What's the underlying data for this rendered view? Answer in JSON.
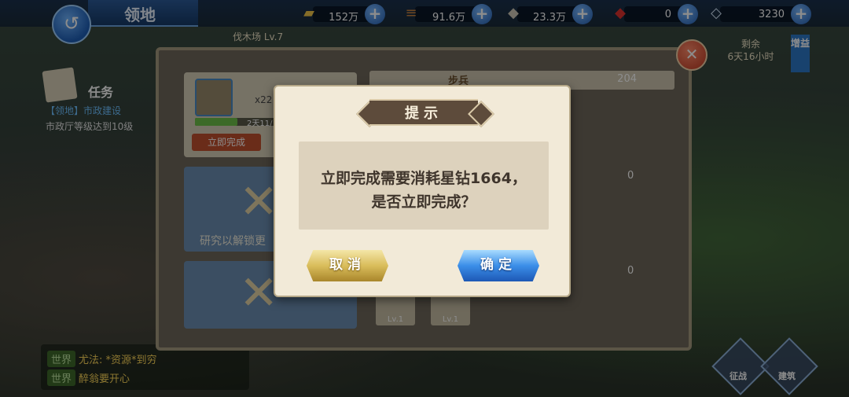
{
  "header": {
    "title": "领地",
    "resources": [
      {
        "icon": "gold-icon",
        "value": "152万"
      },
      {
        "icon": "wood-icon",
        "value": "91.6万"
      },
      {
        "icon": "stone-icon",
        "value": "23.3万"
      },
      {
        "icon": "ruby-icon",
        "value": "0"
      },
      {
        "icon": "diamond-icon",
        "value": "3230"
      }
    ]
  },
  "building": {
    "subtitle": "伐木场 Lv.7",
    "remaining_label": "剩余",
    "remaining_time": "6天16小时",
    "boost_label": "增益"
  },
  "task": {
    "heading": "任务",
    "link": "【领地】市政建设",
    "desc": "市政厅等级达到10级"
  },
  "production": {
    "count": "x22",
    "time": "2天11/",
    "progress": 0.45,
    "finish_now": "立即完成"
  },
  "locked_card": {
    "text": "研究以解锁更"
  },
  "right_rows": [
    {
      "label": "步兵",
      "value": "204"
    },
    {
      "label": "",
      "value": "0"
    },
    {
      "label": "",
      "value": "0"
    }
  ],
  "mini_items": [
    {
      "lv": "Lv.1"
    },
    {
      "lv": "Lv.1"
    }
  ],
  "chat": [
    {
      "tag": "世界",
      "msg": "尤法: *资源*到穷"
    },
    {
      "tag": "世界",
      "msg": "醉翁要开心"
    }
  ],
  "corner_buttons": [
    {
      "label": "征战"
    },
    {
      "label": "建筑"
    }
  ],
  "dialog": {
    "title": "提示",
    "message_line1": "立即完成需要消耗星钻1664，",
    "message_line2": "是否立即完成？",
    "cancel_label": "取消",
    "ok_label": "确定"
  },
  "colors": {
    "cancel_button": "#d9bd5b",
    "ok_button": "#3b8ee8",
    "dialog_bg": "#f2ead8",
    "title_plate": "#5d4b3b"
  }
}
